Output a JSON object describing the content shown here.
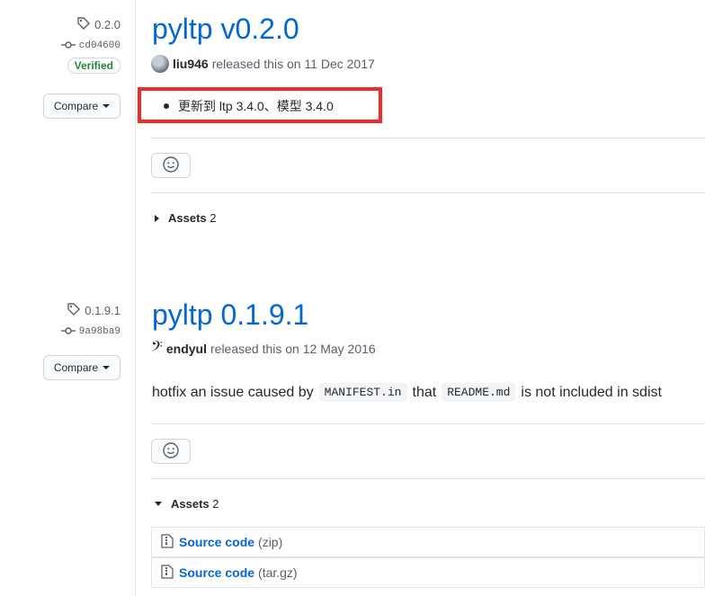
{
  "colors": {
    "link": "#0366d6",
    "muted": "#586069",
    "verified": "#22863a",
    "highlight": "#ef2b2b"
  },
  "release1": {
    "tag": "0.2.0",
    "commit": "cd04600",
    "verified": "Verified",
    "compare_label": "Compare",
    "title": "pyltp v0.2.0",
    "author": "liu946",
    "released_text": "released this on 11 Dec 2017",
    "notes": [
      "更新到 ltp 3.4.0、模型 3.4.0"
    ],
    "assets_label": "Assets",
    "assets_count": "2"
  },
  "release2": {
    "tag": "0.1.9.1",
    "commit": "9a98ba9",
    "compare_label": "Compare",
    "title": "pyltp 0.1.9.1",
    "author": "endyul",
    "released_text": "released this on 12 May 2016",
    "body": {
      "pre": "hotfix an issue caused by",
      "code1": "MANIFEST.in",
      "mid": "that",
      "code2": "README.md",
      "post": "is not included in sdist"
    },
    "assets_label": "Assets",
    "assets_count": "2",
    "assets": [
      {
        "label": "Source code",
        "suffix": "(zip)"
      },
      {
        "label": "Source code",
        "suffix": "(tar.gz)"
      }
    ]
  },
  "icons": [
    "tag-icon",
    "commit-icon",
    "smiley-icon",
    "zip-file-icon",
    "music-clef-icon"
  ]
}
